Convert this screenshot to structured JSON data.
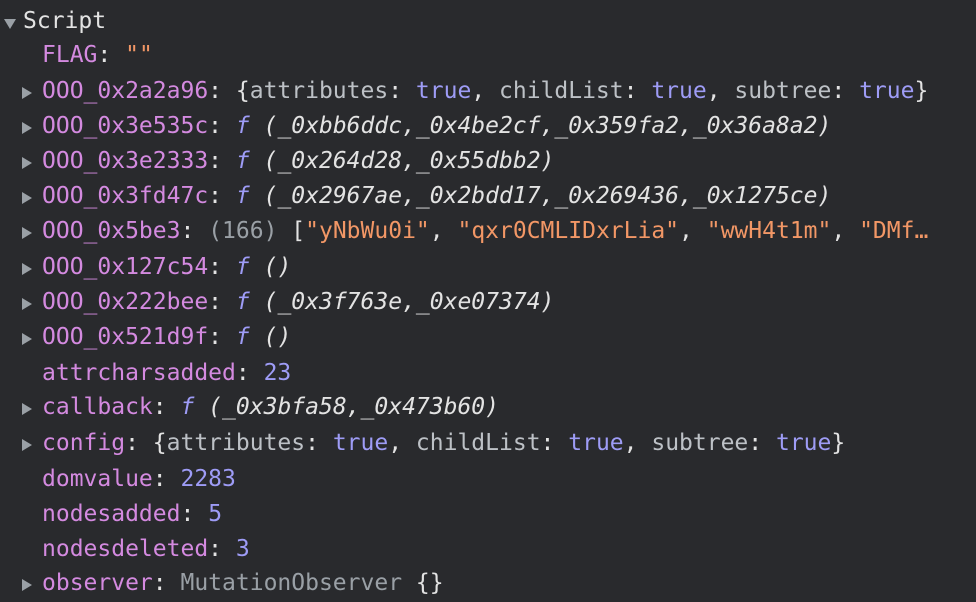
{
  "scope": {
    "header": "Script",
    "rows": [
      {
        "key": "FLAG",
        "value": "\"\""
      },
      {
        "key": "OOO_0x2a2a96",
        "obj": [
          {
            "k": "attributes",
            "v": "true"
          },
          {
            "k": "childList",
            "v": "true"
          },
          {
            "k": "subtree",
            "v": "true"
          }
        ]
      },
      {
        "key": "OOO_0x3e535c",
        "f": "f",
        "args": "(_0xbb6ddc,_0x4be2cf,_0x359fa2,_0x36a8a2)"
      },
      {
        "key": "OOO_0x3e2333",
        "f": "f",
        "args": "(_0x264d28,_0x55dbb2)"
      },
      {
        "key": "OOO_0x3fd47c",
        "f": "f",
        "args": "(_0x2967ae,_0x2bdd17,_0x269436,_0x1275ce)"
      },
      {
        "key": "OOO_0x5be3",
        "count": "(166)",
        "items": [
          "\"yNbWu0i\"",
          "\"qxr0CMLIDxrLia\"",
          "\"wwH4t1m\"",
          "\"DMf…"
        ]
      },
      {
        "key": "OOO_0x127c54",
        "f": "f",
        "args": "()"
      },
      {
        "key": "OOO_0x222bee",
        "f": "f",
        "args": "(_0x3f763e,_0xe07374)"
      },
      {
        "key": "OOO_0x521d9f",
        "f": "f",
        "args": "()"
      },
      {
        "key": "attrcharsadded",
        "value": "23"
      },
      {
        "key": "callback",
        "f": "f",
        "args": "(_0x3bfa58,_0x473b60)"
      },
      {
        "key": "config",
        "obj": [
          {
            "k": "attributes",
            "v": "true"
          },
          {
            "k": "childList",
            "v": "true"
          },
          {
            "k": "subtree",
            "v": "true"
          }
        ]
      },
      {
        "key": "domvalue",
        "value": "2283"
      },
      {
        "key": "nodesadded",
        "value": "5"
      },
      {
        "key": "nodesdeleted",
        "value": "3"
      },
      {
        "key": "observer",
        "type": "MutationObserver",
        "value": "{}"
      }
    ]
  }
}
